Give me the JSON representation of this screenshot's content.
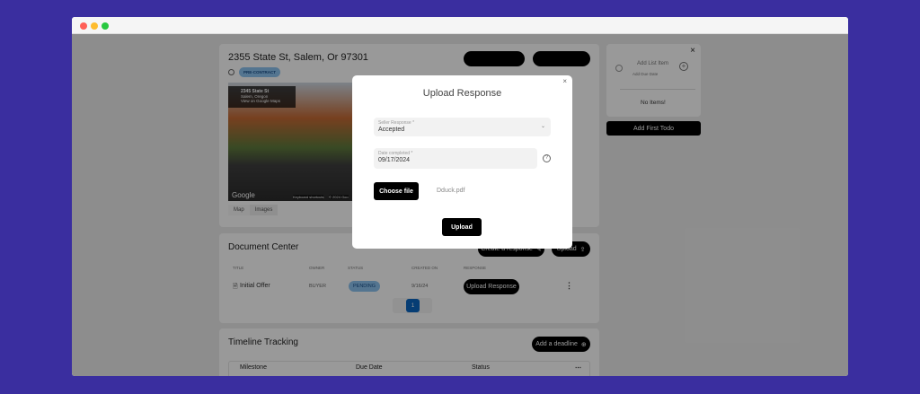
{
  "property": {
    "address": "2355 State St, Salem, Or 97301",
    "status_badge": "PRE-CONTRACT",
    "map_overlay": {
      "title": "2345 State St",
      "subtitle": "Salem, Oregon",
      "link": "View on Google Maps"
    },
    "map_footer": {
      "logo": "Google",
      "shortcuts": "Keyboard shortcuts",
      "copyright": "© 2024 Goo"
    },
    "tabs": [
      "Map",
      "Images"
    ]
  },
  "document_center": {
    "title": "Document Center",
    "create_label": "Create a response",
    "upload_label": "Upload",
    "columns": [
      "Title",
      "Owner",
      "Status",
      "Created On",
      "Response"
    ],
    "rows": [
      {
        "title": "Initial Offer",
        "owner": "BUYER",
        "status": "PENDING",
        "created": "9/16/24",
        "action": "Upload Response"
      }
    ],
    "page": "1"
  },
  "timeline": {
    "title": "Timeline Tracking",
    "add_label": "Add a deadline",
    "columns": [
      "Milestone",
      "Due Date",
      "Status"
    ]
  },
  "todo": {
    "add_item_placeholder": "Add List Item",
    "add_due_date": "Add Due Date",
    "empty": "No Items!",
    "add_first": "Add First Todo"
  },
  "modal": {
    "title": "Upload Response",
    "response_label": "Seller Response *",
    "response_value": "Accepted",
    "date_label": "Date completed *",
    "date_value": "09/17/2024",
    "choose_file": "Choose file",
    "file_name": "Dduck.pdf",
    "upload": "Upload"
  },
  "colors": {
    "background": "#3a2e9f",
    "badge": "#8cc4f0",
    "page_active": "#0a66c2"
  }
}
